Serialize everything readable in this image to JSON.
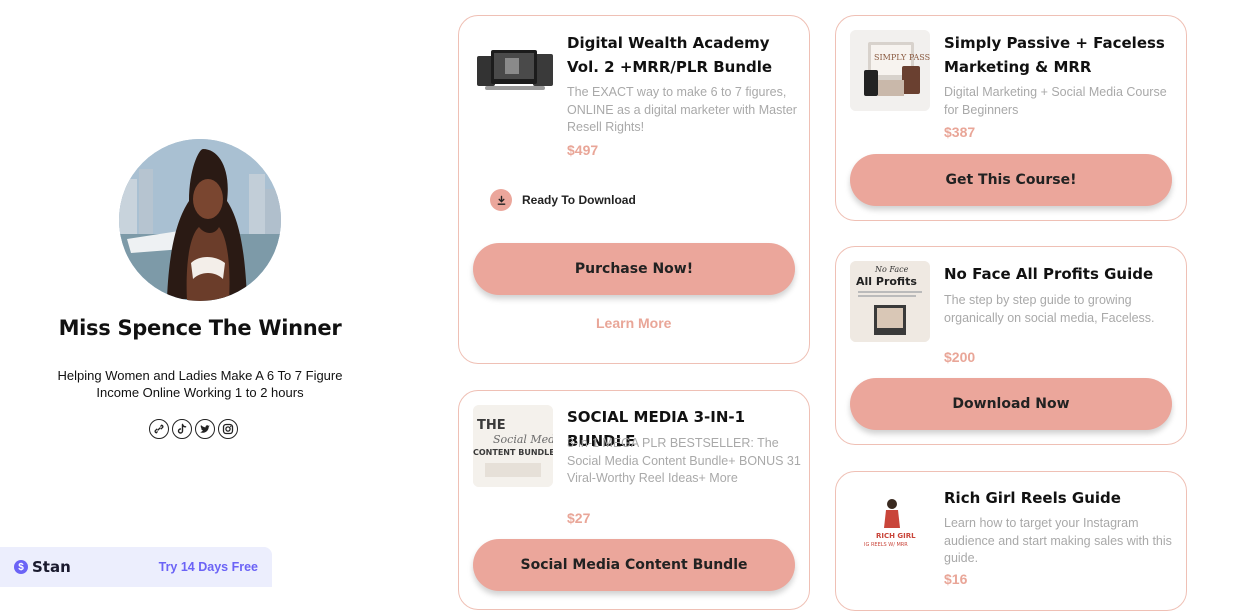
{
  "profile": {
    "name": "Miss Spence The Winner",
    "bio": "Helping Women and Ladies Make A 6 To 7 Figure Income Online Working 1 to 2 hours",
    "socials": [
      "link-icon",
      "tiktok-icon",
      "twitter-icon",
      "instagram-icon"
    ]
  },
  "stan": {
    "brand": "Stan",
    "cta": "Try 14 Days Free"
  },
  "colors": {
    "accent": "#eba69b",
    "price": "#e9a698",
    "card_border": "#efc0b5",
    "stan_accent": "#6b63f6"
  },
  "products": {
    "digital_wealth": {
      "title": "Digital Wealth Academy Vol. 2 +MRR/PLR Bundle",
      "description": "The EXACT way to make 6 to 7 figures, ONLINE as a digital marketer with Master Resell Rights!",
      "price": "$497",
      "status": "Ready To Download",
      "button": "Purchase Now!",
      "link": "Learn More"
    },
    "simply_passive": {
      "title": "Simply Passive + Faceless Marketing & MRR",
      "description": "Digital Marketing + Social Media Course for Beginners",
      "price": "$387",
      "button": "Get This Course!",
      "thumb_text": "SIMPLY PASSIVE"
    },
    "no_face": {
      "title": "No Face All Profits Guide",
      "description": "The step by step guide to growing organically on social media, Faceless.",
      "price": "$200",
      "button": "Download Now",
      "thumb_line1": "No Face",
      "thumb_line2": "All Profits"
    },
    "social_media": {
      "title": "SOCIAL MEDIA 3-IN-1 BUNDLE",
      "description": "3-in-1 MEGA PLR BESTSELLER: The Social Media Content Bundle+ BONUS 31 Viral-Worthy Reel Ideas+ More",
      "price": "$27",
      "button": "Social Media Content Bundle",
      "thumb_line1": "THE",
      "thumb_line2": "Social Media",
      "thumb_line3": "CONTENT BUNDLE"
    },
    "rich_girl": {
      "title": "Rich Girl Reels Guide",
      "description": "Learn how to target your Instagram audience and start making sales with this guide.",
      "price": "$16",
      "thumb_line1": "RICH GIRL",
      "thumb_line2": "IG REELS W/ MRR"
    }
  }
}
